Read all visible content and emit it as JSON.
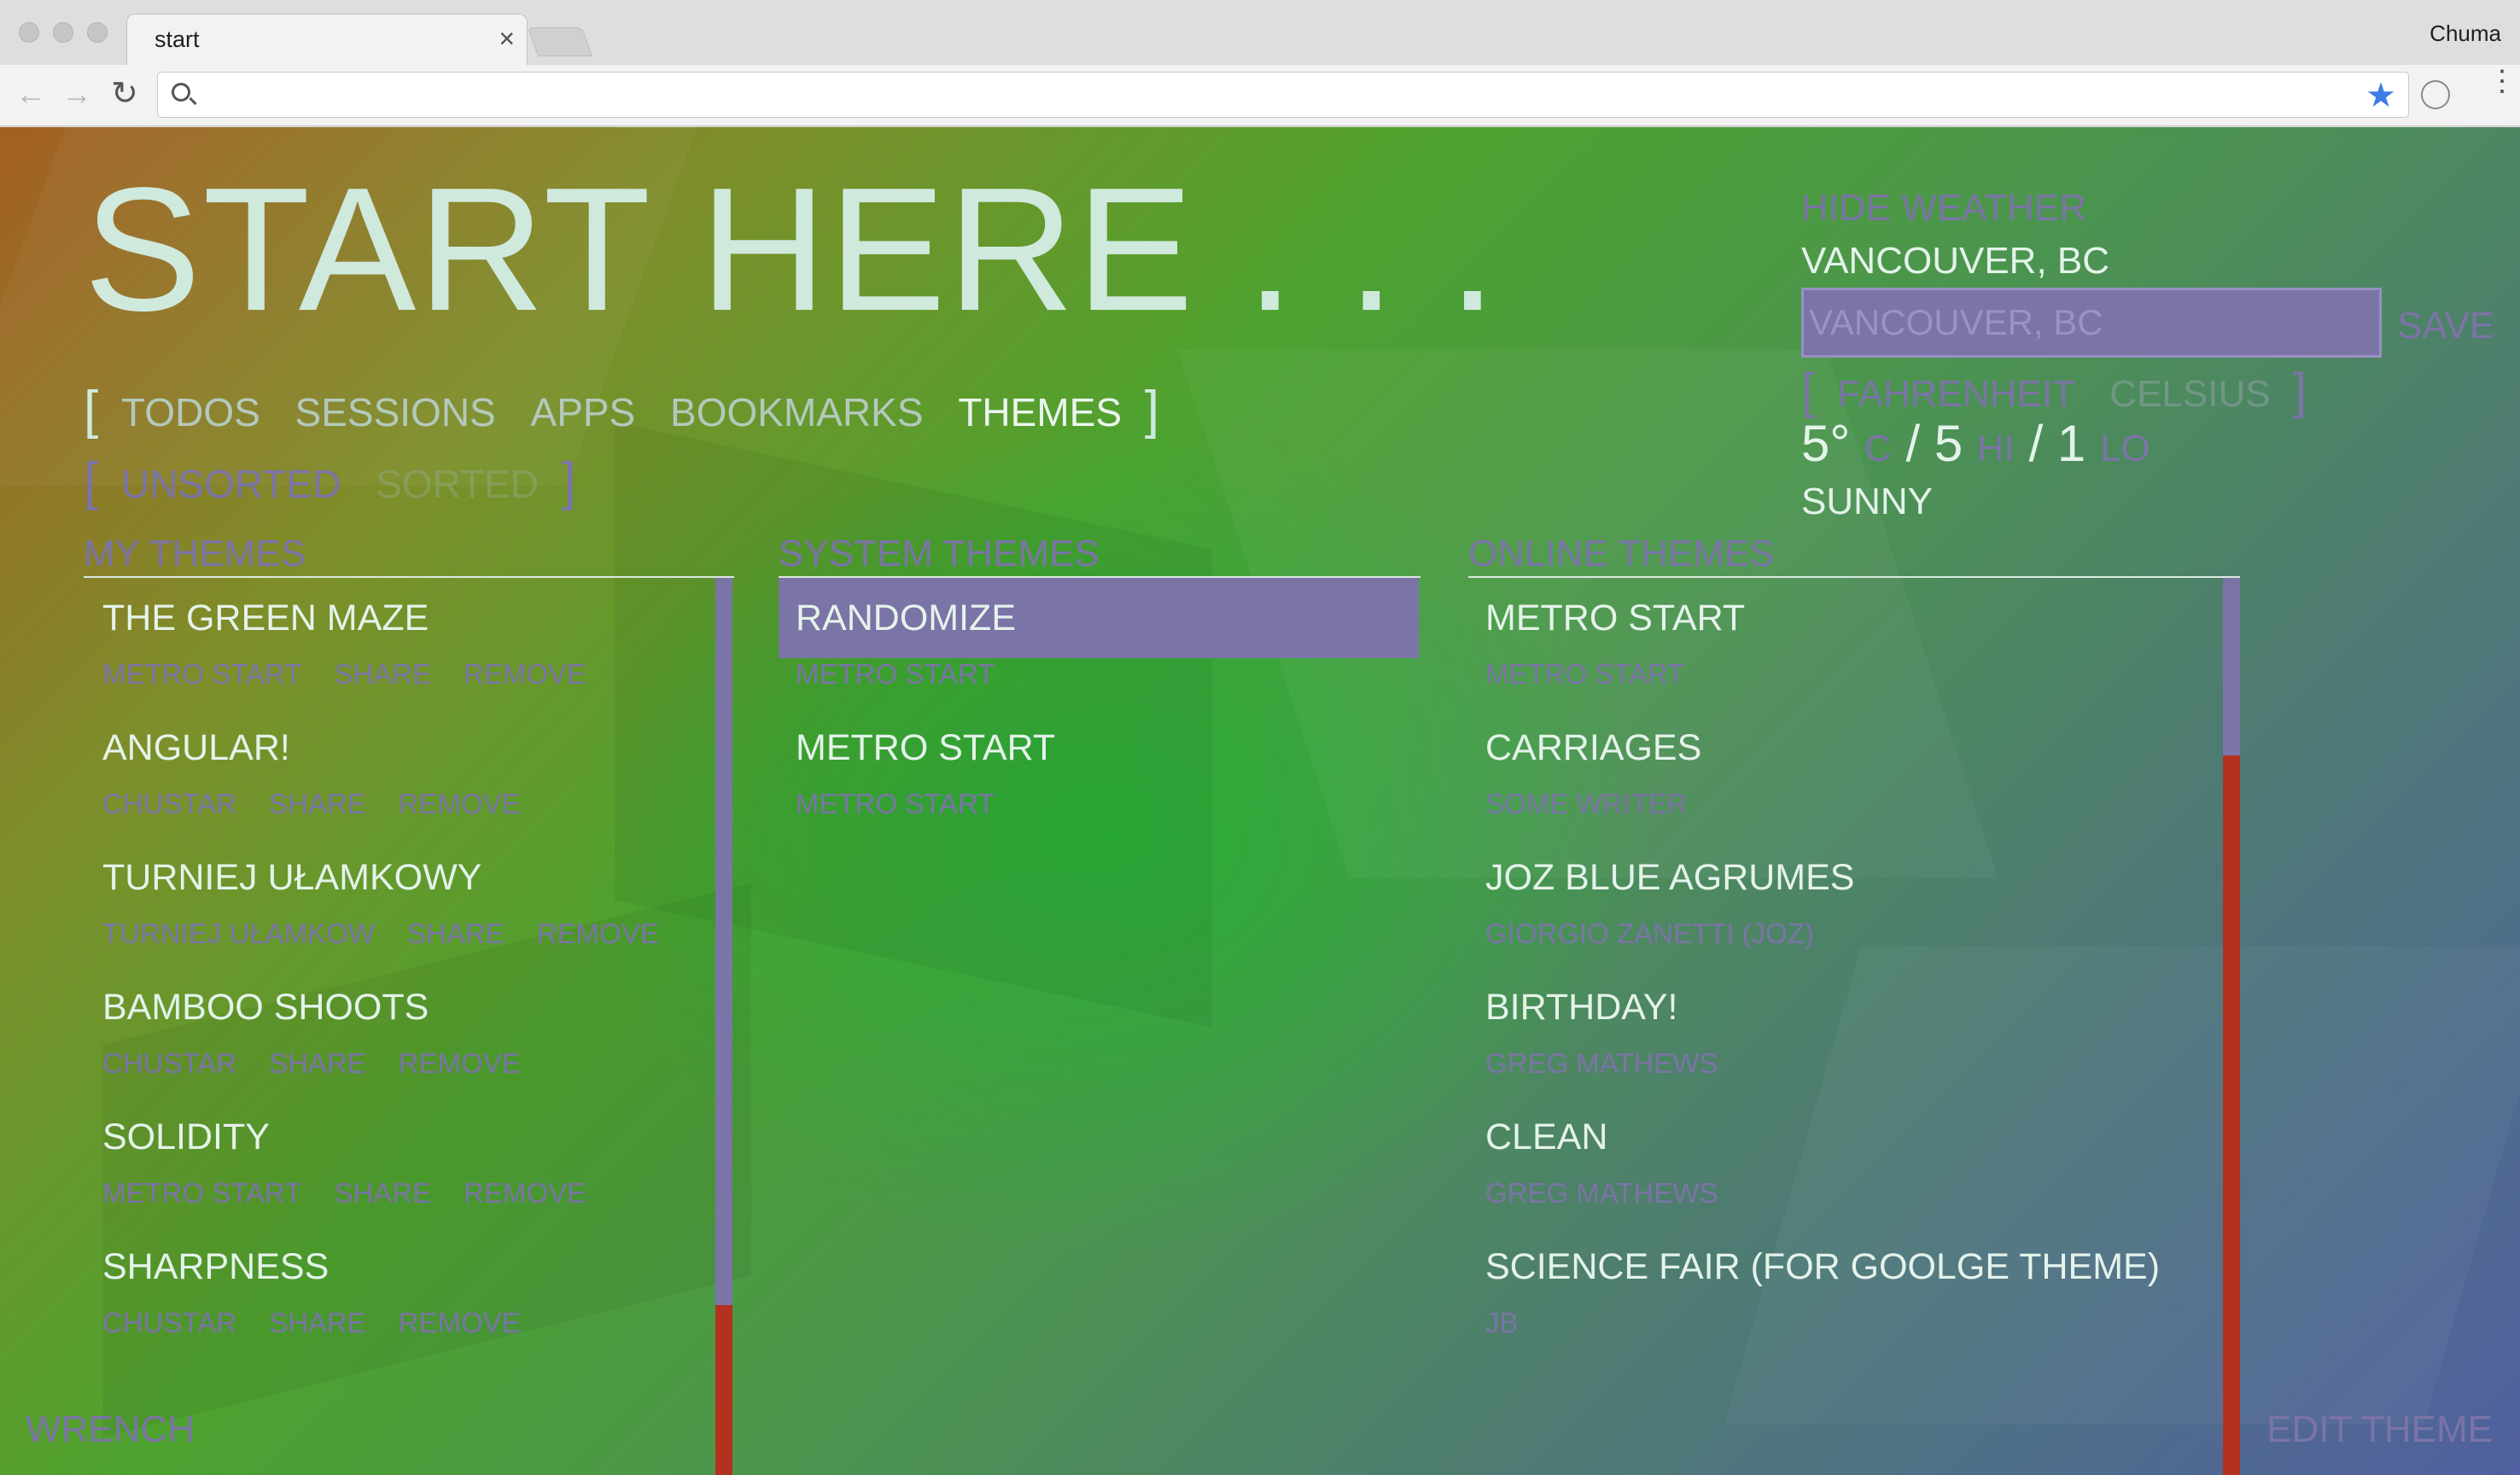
{
  "browser": {
    "tab_title": "start",
    "tab_close": "×",
    "profile_name": "Chuma",
    "address_value": "",
    "back_glyph": "←",
    "forward_glyph": "→",
    "reload_glyph": "↻",
    "star_glyph": "★",
    "menu_glyph": "⋮"
  },
  "page": {
    "title": "START HERE . . .",
    "nav": {
      "open_bracket": "[",
      "close_bracket": "]",
      "items": [
        "TODOS",
        "SESSIONS",
        "APPS",
        "BOOKMARKS",
        "THEMES"
      ],
      "active": "THEMES"
    },
    "sort": {
      "open_bracket": "[",
      "close_bracket": "]",
      "unsorted": "UNSORTED",
      "sorted": "SORTED"
    },
    "columns": {
      "my_themes": {
        "heading": "MY THEMES",
        "items": [
          {
            "name": "THE GREEN MAZE",
            "author": "METRO START",
            "share": "SHARE",
            "remove": "REMOVE"
          },
          {
            "name": "ANGULAR!",
            "author": "CHUSTAR",
            "share": "SHARE",
            "remove": "REMOVE"
          },
          {
            "name": "TURNIEJ UŁAMKOWY",
            "author": "TURNIEJ UŁAMKOW",
            "share": "SHARE",
            "remove": "REMOVE"
          },
          {
            "name": "BAMBOO SHOOTS",
            "author": "CHUSTAR",
            "share": "SHARE",
            "remove": "REMOVE"
          },
          {
            "name": "SOLIDITY",
            "author": "METRO START",
            "share": "SHARE",
            "remove": "REMOVE"
          },
          {
            "name": "SHARPNESS",
            "author": "CHUSTAR",
            "share": "SHARE",
            "remove": "REMOVE"
          }
        ]
      },
      "system_themes": {
        "heading": "SYSTEM THEMES",
        "items": [
          {
            "name": "RANDOMIZE",
            "author": "METRO START"
          },
          {
            "name": "METRO START",
            "author": "METRO START"
          }
        ]
      },
      "online_themes": {
        "heading": "ONLINE THEMES",
        "items": [
          {
            "name": "METRO START",
            "author": "METRO START"
          },
          {
            "name": "CARRIAGES",
            "author": "SOME WRITER"
          },
          {
            "name": "JOZ BLUE AGRUMES",
            "author": "GIORGIO ZANETTI (JOZ)"
          },
          {
            "name": "BIRTHDAY!",
            "author": "GREG MATHEWS"
          },
          {
            "name": "CLEAN",
            "author": "GREG MATHEWS"
          },
          {
            "name": "SCIENCE FAIR (FOR GOOLGE THEME)",
            "author": "JB"
          }
        ]
      }
    },
    "weather": {
      "hide_label": "HIDE WEATHER",
      "city": "VANCOUVER, BC",
      "input_placeholder": "VANCOUVER, BC",
      "save_label": "SAVE",
      "open_bracket": "[",
      "close_bracket": "]",
      "fahrenheit": "FAHRENHEIT",
      "celsius": "CELSIUS",
      "current_temp": "5°",
      "unit_label": "C",
      "separator": "/",
      "high": "5",
      "high_label": "HI",
      "low": "1",
      "low_label": "LO",
      "condition": "SUNNY"
    },
    "footer": {
      "left_label": "WRENCH",
      "right_label": "EDIT THEME"
    },
    "colors": {
      "accent": "#7b74a6",
      "scroll_track": "#b3321f"
    }
  }
}
